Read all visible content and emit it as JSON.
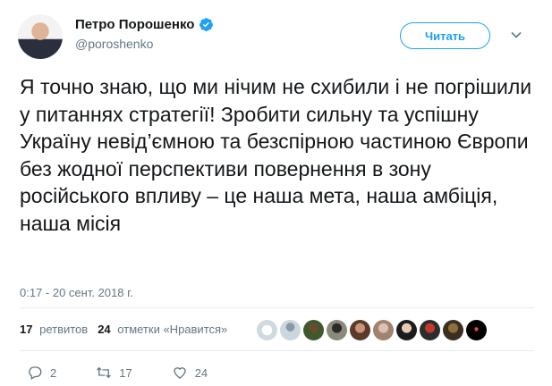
{
  "author": {
    "display_name": "Петро Порошенко",
    "handle": "@poroshenko",
    "verified_icon": "verified-badge-icon"
  },
  "follow_button": {
    "label": "Читать"
  },
  "tweet": {
    "text": "Я точно знаю, що ми нічим не схибили і не погрішили у питаннях стратегії! Зробити сильну та успішну Україну невід’ємною та безспірною частиною Європи без жодної перспективи повернення в зону російського впливу – це наша мета, наша амбіція, наша місія",
    "timestamp": "0:17 - 20 сент. 2018 г."
  },
  "stats": {
    "retweets_count": "17",
    "retweets_label": "ретвитов",
    "likes_count": "24",
    "likes_label": "отметки «Нравится»"
  },
  "actions": {
    "reply_count": "2",
    "retweet_count": "17",
    "like_count": "24"
  },
  "colors": {
    "accent": "#1da1f2",
    "text": "#14171a",
    "secondary": "#657786"
  }
}
